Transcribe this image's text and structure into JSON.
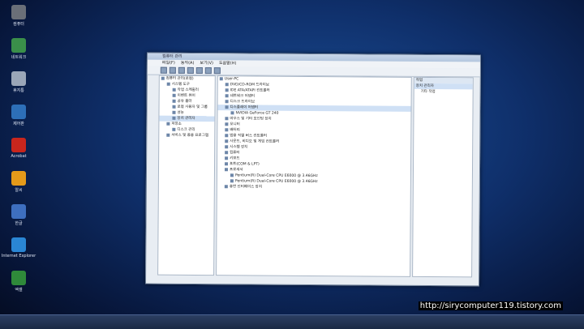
{
  "desktop_icons": [
    {
      "name": "icon-1",
      "label": "컴퓨터",
      "color": "#6a6f78"
    },
    {
      "name": "icon-2",
      "label": "네트워크",
      "color": "#3a8f4a"
    },
    {
      "name": "icon-3",
      "label": "휴지통",
      "color": "#9aa6b8"
    },
    {
      "name": "icon-4",
      "label": "제어판",
      "color": "#2d6fb8"
    },
    {
      "name": "icon-5",
      "label": "Acrobat",
      "color": "#c8261d"
    },
    {
      "name": "icon-6",
      "label": "알씨",
      "color": "#e59a1a"
    },
    {
      "name": "icon-7",
      "label": "한글",
      "color": "#3e6fbf"
    },
    {
      "name": "icon-8",
      "label": "Internet Explorer",
      "color": "#2a86d4"
    },
    {
      "name": "icon-9",
      "label": "엑셀",
      "color": "#2f8a3a"
    }
  ],
  "window": {
    "title": "컴퓨터 관리",
    "menu": [
      "파일(F)",
      "동작(A)",
      "보기(V)",
      "도움말(H)"
    ],
    "left_tree": [
      {
        "label": "컴퓨터 관리(로컬)",
        "indent": 0,
        "selected": false
      },
      {
        "label": "시스템 도구",
        "indent": 1,
        "selected": false
      },
      {
        "label": "작업 스케줄러",
        "indent": 2,
        "selected": false
      },
      {
        "label": "이벤트 뷰어",
        "indent": 2,
        "selected": false
      },
      {
        "label": "공유 폴더",
        "indent": 2,
        "selected": false
      },
      {
        "label": "로컬 사용자 및 그룹",
        "indent": 2,
        "selected": false
      },
      {
        "label": "성능",
        "indent": 2,
        "selected": false
      },
      {
        "label": "장치 관리자",
        "indent": 2,
        "selected": true
      },
      {
        "label": "저장소",
        "indent": 1,
        "selected": false
      },
      {
        "label": "디스크 관리",
        "indent": 2,
        "selected": false
      },
      {
        "label": "서비스 및 응용 프로그램",
        "indent": 1,
        "selected": false
      }
    ],
    "center_tree": [
      {
        "label": "User-PC",
        "indent": 0,
        "selected": false
      },
      {
        "label": "DVD/CD-ROM 드라이브",
        "indent": 1,
        "selected": false
      },
      {
        "label": "IDE ATA/ATAPI 컨트롤러",
        "indent": 1,
        "selected": false
      },
      {
        "label": "네트워크 어댑터",
        "indent": 1,
        "selected": false
      },
      {
        "label": "디스크 드라이브",
        "indent": 1,
        "selected": false
      },
      {
        "label": "디스플레이 어댑터",
        "indent": 1,
        "selected": true
      },
      {
        "label": "NVIDIA GeForce GT 240",
        "indent": 2,
        "selected": false
      },
      {
        "label": "마우스 및 기타 포인팅 장치",
        "indent": 1,
        "selected": false
      },
      {
        "label": "모니터",
        "indent": 1,
        "selected": false
      },
      {
        "label": "배터리",
        "indent": 1,
        "selected": false
      },
      {
        "label": "범용 직렬 버스 컨트롤러",
        "indent": 1,
        "selected": false
      },
      {
        "label": "사운드, 비디오 및 게임 컨트롤러",
        "indent": 1,
        "selected": false
      },
      {
        "label": "시스템 장치",
        "indent": 1,
        "selected": false
      },
      {
        "label": "컴퓨터",
        "indent": 1,
        "selected": false
      },
      {
        "label": "키보드",
        "indent": 1,
        "selected": false
      },
      {
        "label": "포트(COM & LPT)",
        "indent": 1,
        "selected": false
      },
      {
        "label": "프로세서",
        "indent": 1,
        "selected": false
      },
      {
        "label": "Pentium(R) Dual-Core  CPU      E6000  @ 3.46GHz",
        "indent": 2,
        "selected": false
      },
      {
        "label": "Pentium(R) Dual-Core  CPU      E6000  @ 3.46GHz",
        "indent": 2,
        "selected": false
      },
      {
        "label": "휴먼 인터페이스 장치",
        "indent": 1,
        "selected": false
      }
    ],
    "actions": {
      "header": "작업",
      "section": "장치 관리자",
      "item": "기타 작업"
    }
  },
  "watermark": "http://sirycomputer119.tistory.com"
}
